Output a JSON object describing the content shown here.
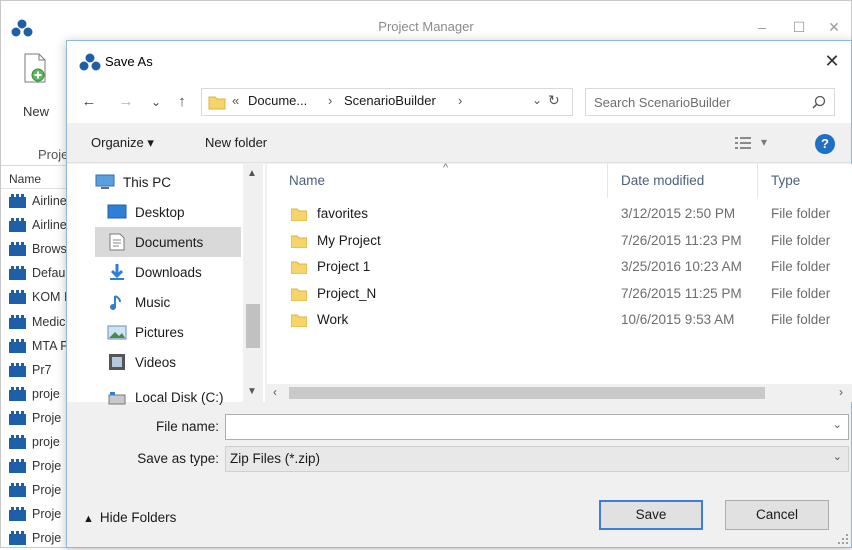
{
  "app": {
    "title": "Project Manager",
    "ribbon": {
      "new_label": "New",
      "group_label": "Proje"
    },
    "list_header": "Name",
    "list_items": [
      "Airline",
      "Airline",
      "Brows",
      "Defau",
      "KOM I",
      "Medic",
      "MTA P",
      "Pr7",
      "proje",
      "Proje",
      "proje",
      "Proje",
      "Proje",
      "Proje",
      "Proje"
    ],
    "window_buttons": {
      "minimize": "–",
      "maximize": "☐",
      "close": "✕"
    }
  },
  "dialog": {
    "title": "Save As",
    "close_glyph": "✕",
    "nav": {
      "back": "←",
      "forward": "→",
      "recent": "⌄",
      "up": "↑",
      "refresh": "↻"
    },
    "address": {
      "prefix": "«",
      "segments": [
        "Docume...",
        "ScenarioBuilder"
      ],
      "separator": "›",
      "dropdown": "⌄"
    },
    "search": {
      "placeholder": "Search ScenarioBuilder",
      "icon": "search-icon"
    },
    "toolbar": {
      "organize": "Organize ▾",
      "new_folder": "New folder",
      "view": "▾",
      "help": "?"
    },
    "nav_pane": {
      "items": [
        {
          "label": "This PC",
          "icon": "computer-icon"
        },
        {
          "label": "Desktop",
          "icon": "desktop-icon"
        },
        {
          "label": "Documents",
          "icon": "documents-icon",
          "selected": true
        },
        {
          "label": "Downloads",
          "icon": "downloads-icon"
        },
        {
          "label": "Music",
          "icon": "music-icon"
        },
        {
          "label": "Pictures",
          "icon": "pictures-icon"
        },
        {
          "label": "Videos",
          "icon": "videos-icon"
        },
        {
          "label": "Local Disk (C:)",
          "icon": "drive-icon"
        }
      ]
    },
    "file_list": {
      "columns": [
        "Name",
        "Date modified",
        "Type"
      ],
      "rows": [
        {
          "name": "favorites",
          "date": "3/12/2015 2:50 PM",
          "type": "File folder"
        },
        {
          "name": "My Project",
          "date": "7/26/2015 11:23 PM",
          "type": "File folder"
        },
        {
          "name": "Project 1",
          "date": "3/25/2016 10:23 AM",
          "type": "File folder"
        },
        {
          "name": "Project_N",
          "date": "7/26/2015 11:25 PM",
          "type": "File folder"
        },
        {
          "name": "Work",
          "date": "10/6/2015 9:53 AM",
          "type": "File folder"
        }
      ]
    },
    "form": {
      "file_name_label": "File name:",
      "file_name_value": "",
      "save_as_type_label": "Save as type:",
      "save_as_type_value": "Zip Files (*.zip)"
    },
    "hide_folders": "Hide Folders",
    "save_label": "Save",
    "cancel_label": "Cancel",
    "colors": {
      "accent": "#3c7fd6",
      "folder": "#f5d56b",
      "selection": "#d9d9d9",
      "column_header": "#4c607a"
    }
  }
}
